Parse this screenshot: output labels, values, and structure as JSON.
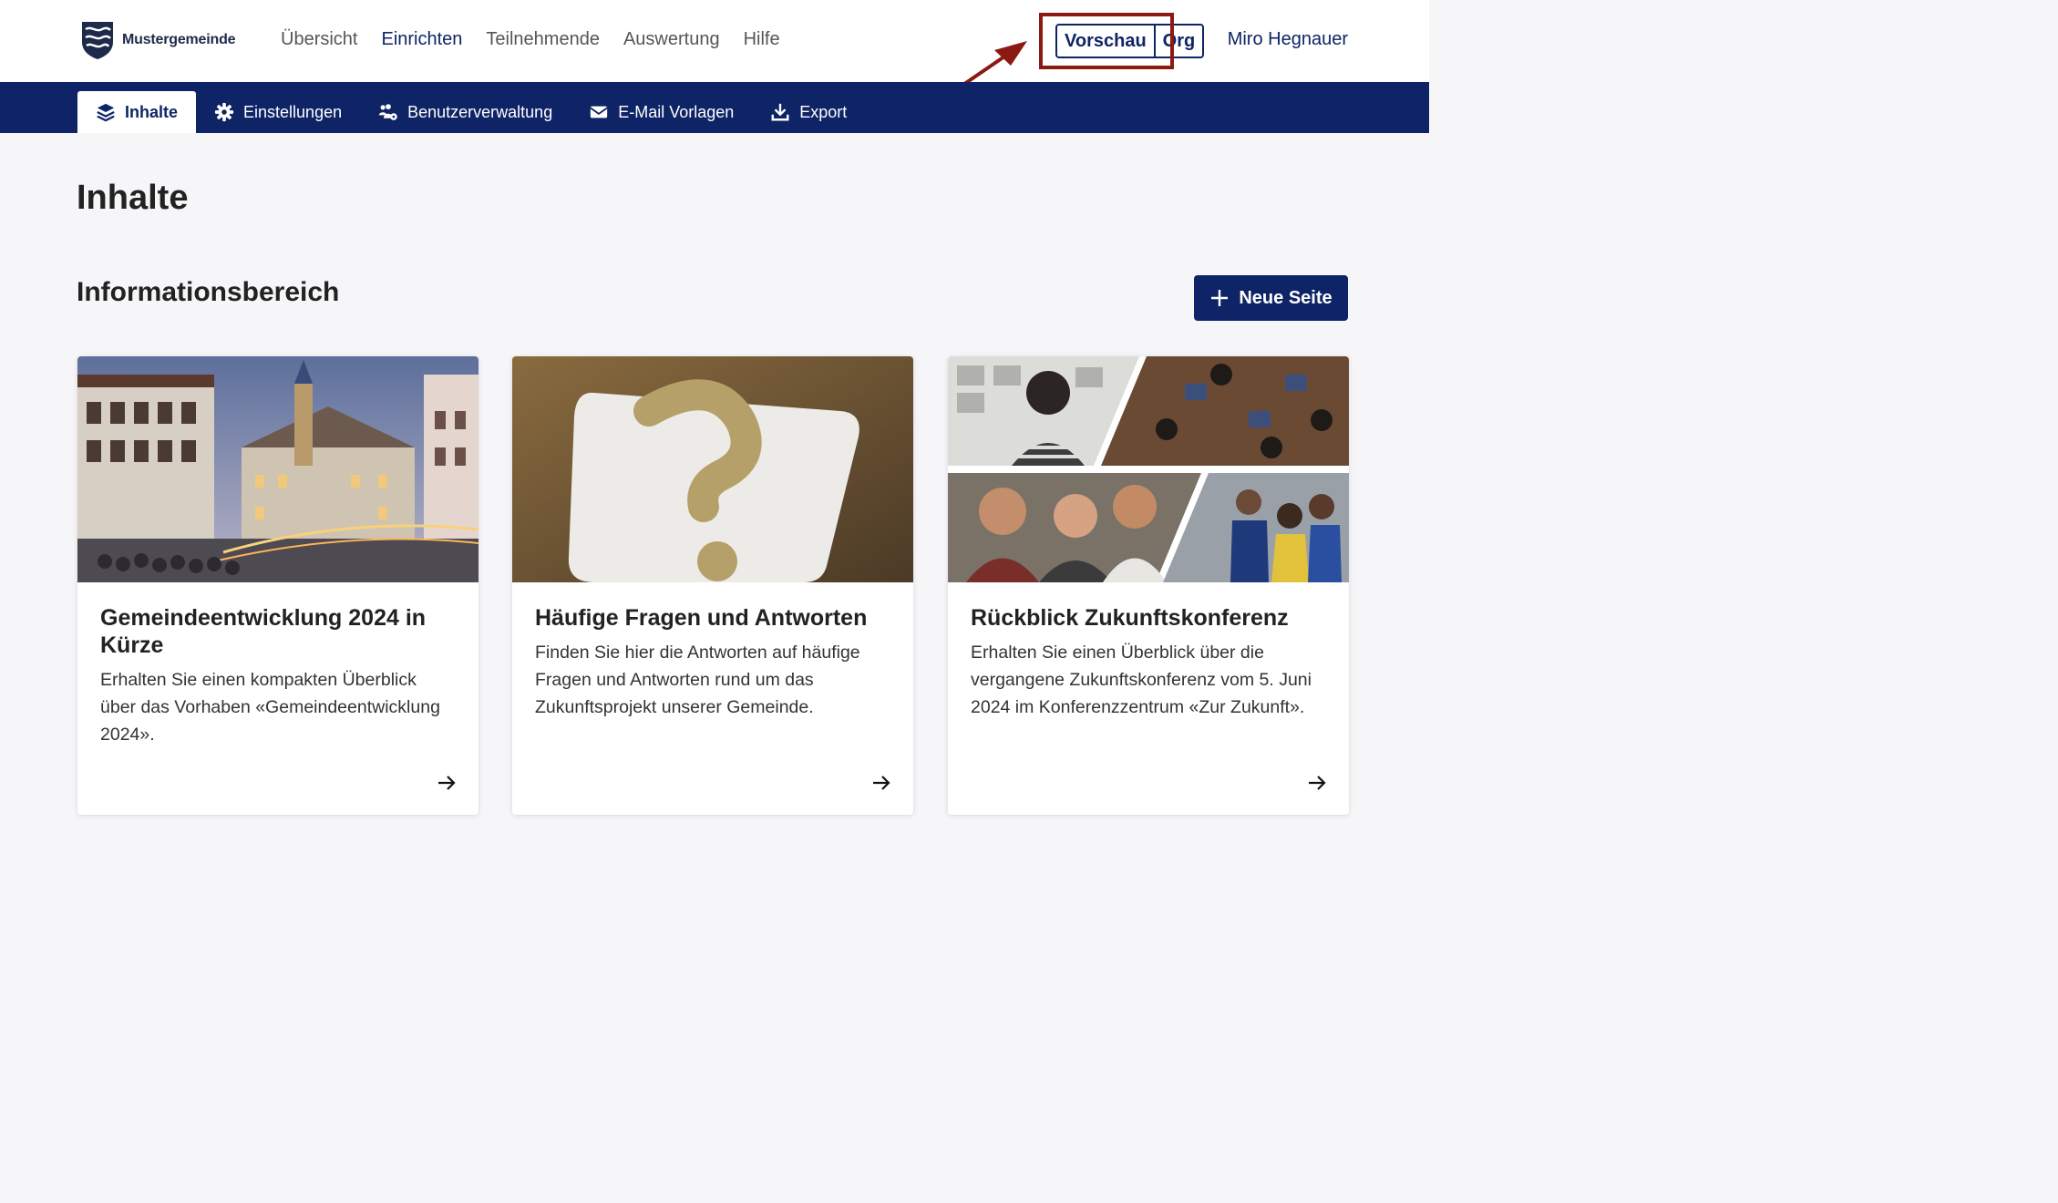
{
  "brand": {
    "name": "Mustergemeinde",
    "logo_icon": "coat-of-arms-icon"
  },
  "main_nav": {
    "items": [
      {
        "label": "Übersicht",
        "active": false
      },
      {
        "label": "Einrichten",
        "active": true
      },
      {
        "label": "Teilnehmende",
        "active": false
      },
      {
        "label": "Auswertung",
        "active": false
      },
      {
        "label": "Hilfe",
        "active": false
      }
    ]
  },
  "view_toggle": {
    "preview_label": "Vorschau",
    "org_label": "Org"
  },
  "user": {
    "name": "Miro Hegnauer"
  },
  "sub_nav": {
    "items": [
      {
        "label": "Inhalte",
        "icon": "layers-icon",
        "active": true
      },
      {
        "label": "Einstellungen",
        "icon": "gear-icon",
        "active": false
      },
      {
        "label": "Benutzerverwaltung",
        "icon": "users-cog-icon",
        "active": false
      },
      {
        "label": "E-Mail Vorlagen",
        "icon": "envelope-icon",
        "active": false
      },
      {
        "label": "Export",
        "icon": "download-icon",
        "active": false
      }
    ]
  },
  "page": {
    "title": "Inhalte",
    "section_title": "Informationsbereich",
    "new_page_button": "Neue Seite"
  },
  "cards": [
    {
      "title": "Gemeindeentwicklung 2024 in Kürze",
      "text": "Erhalten Sie einen kompakten Überblick über das Vorhaben «Gemeindeentwicklung 2024».",
      "image": "town-square-photo"
    },
    {
      "title": "Häufige Fragen und Antworten",
      "text": "Finden Sie hier die Antworten auf häufige Fragen und Antworten rund um das Zukunftsprojekt unserer Gemeinde.",
      "image": "question-mark-photo"
    },
    {
      "title": "Rückblick Zukunftskonferenz",
      "text": "Erhalten Sie einen Überblick über die vergangene Zukunftskonferenz vom 5. Juni 2024 im Konferenzzentrum «Zur Zukunft».",
      "image": "conference-collage-photo"
    }
  ],
  "colors": {
    "primary": "#0e2466",
    "annotation": "#8b1a12",
    "background": "#f6f6f8"
  }
}
